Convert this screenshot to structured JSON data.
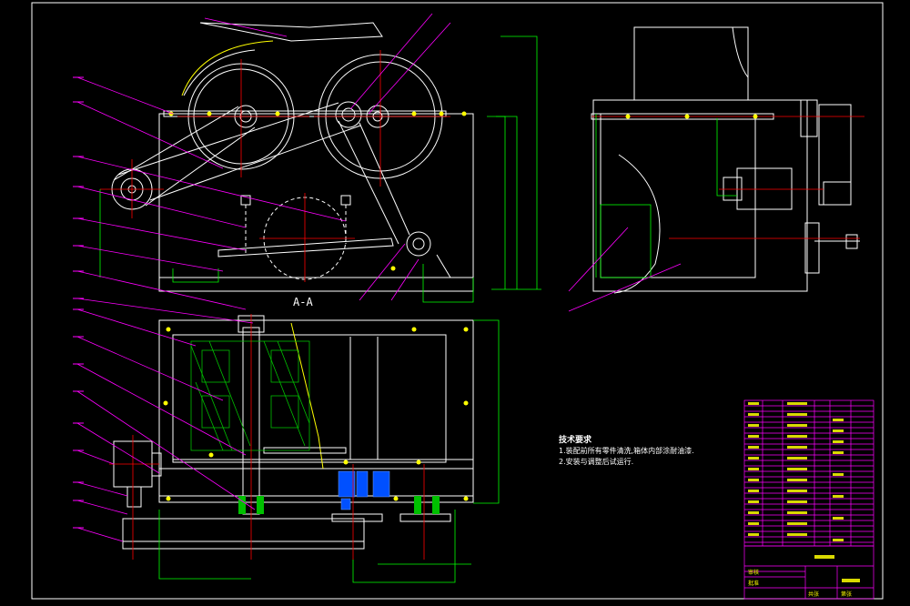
{
  "drawing": {
    "section_label": "A-A",
    "notes_title": "技术要求",
    "notes": [
      "1.装配前所有零件清洗,箱体内部涂耐油漆.",
      "2.安装与调整后试运行."
    ]
  },
  "colors": {
    "background": "#000000",
    "outline": "#ffffff",
    "leader": "#ff00ff",
    "dimension": "#00ff00",
    "centerline": "#ff0000",
    "bolt": "#ffff00",
    "table_lines": "#ff00ff",
    "table_text": "#ffff00",
    "hatch_green": "#00c000",
    "hatch_blue": "#0050ff"
  },
  "title_block": {
    "cells": [
      "审核",
      "批准",
      "共张",
      "第张"
    ]
  }
}
